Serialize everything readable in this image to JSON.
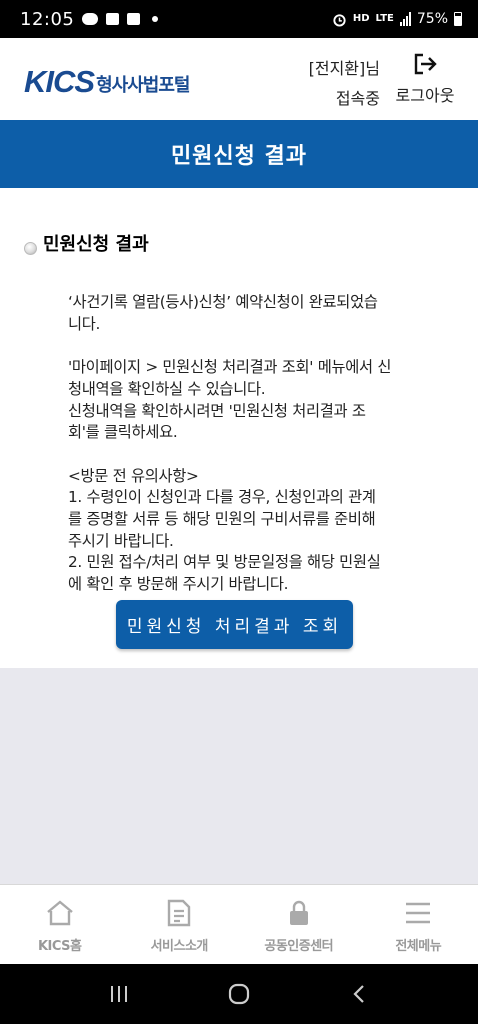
{
  "status_bar": {
    "time": "12:05",
    "talk_label": "TALK",
    "network_hd": "HD",
    "network_voice": "VOICE",
    "network_lte": "LTE",
    "battery": "75%"
  },
  "header": {
    "logo_mark": "KICS",
    "logo_subtitle": "형사사법포털",
    "user_name": "[전지환]님",
    "user_status": "접속중",
    "logout_label": "로그아웃"
  },
  "page": {
    "title": "민원신청 결과",
    "section_title": "민원신청 결과",
    "message_lines": [
      "‘사건기록 열람(등사)신청’ 예약신청이 완료되었습",
      "니다."
    ],
    "menu_lines": [
      "'마이페이지 > 민원신청 처리결과 조회' 메뉴에서 신",
      "청내역을 확인하실 수 있습니다.",
      "신청내역을 확인하시려면 '민원신청 처리결과 조",
      "회'를 클릭하세요."
    ],
    "notice_lines": [
      "<방문 전 유의사항>",
      "1. 수령인이 신청인과 다를 경우, 신청인과의 관계",
      "를 증명할 서류 등 해당 민원의 구비서류를 준비해",
      "주시기 바랍니다.",
      "2. 민원 접수/처리 여부 및 방문일정을 해당 민원실",
      "에 확인 후 방문해 주시기 바랍니다."
    ],
    "check_button": "민원신청 처리결과 조회"
  },
  "bottom_nav": {
    "items": [
      {
        "label": "KICS홈",
        "icon": "home-icon"
      },
      {
        "label": "서비스소개",
        "icon": "document-icon"
      },
      {
        "label": "공동인증센터",
        "icon": "lock-icon"
      },
      {
        "label": "전체메뉴",
        "icon": "menu-icon"
      }
    ]
  },
  "system_nav": {
    "icons": [
      "recent-apps-icon",
      "home-circle-icon",
      "back-icon"
    ]
  }
}
